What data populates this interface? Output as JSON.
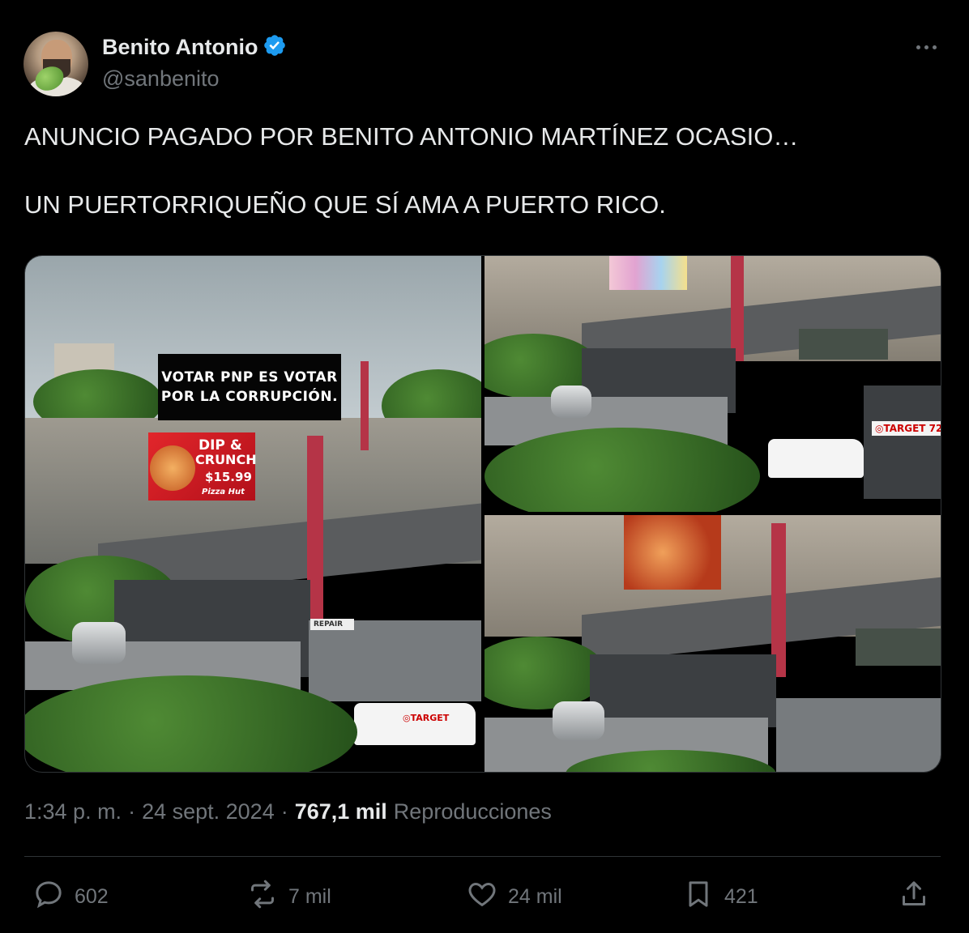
{
  "author": {
    "name": "Benito Antonio",
    "verified": true,
    "handle": "@sanbenito",
    "avatar_icon": "profile-photo"
  },
  "tweet": {
    "lines": [
      "ANUNCIO PAGADO POR BENITO ANTONIO MARTÍNEZ OCASIO…",
      "UN PUERTORRIQUEÑO QUE SÍ AMA A PUERTO RICO."
    ]
  },
  "media": {
    "billboard_line1": "VOTAR PNP ES VOTAR",
    "billboard_line2": "POR LA CORRUPCIÓN.",
    "ad_dip": "DIP &",
    "ad_crunch": "CRUNCH",
    "ad_price": "$15.99",
    "ad_brand": "Pizza Hut",
    "target_label_1": "◎TARGET 72",
    "target_label_2": "◎TARGET",
    "repair_label": "REPAIR"
  },
  "meta": {
    "time": "1:34 p. m.",
    "sep1": "·",
    "date": "24 sept. 2024",
    "sep2": "·",
    "views": "767,1 mil",
    "views_label": "Reproducciones"
  },
  "actions": {
    "replies": "602",
    "reposts": "7 mil",
    "likes": "24 mil",
    "bookmarks": "421"
  },
  "colors": {
    "background": "#000000",
    "text": "#e7e9ea",
    "secondary": "#71767b",
    "verified": "#1d9bf0",
    "divider": "#2f3336"
  }
}
